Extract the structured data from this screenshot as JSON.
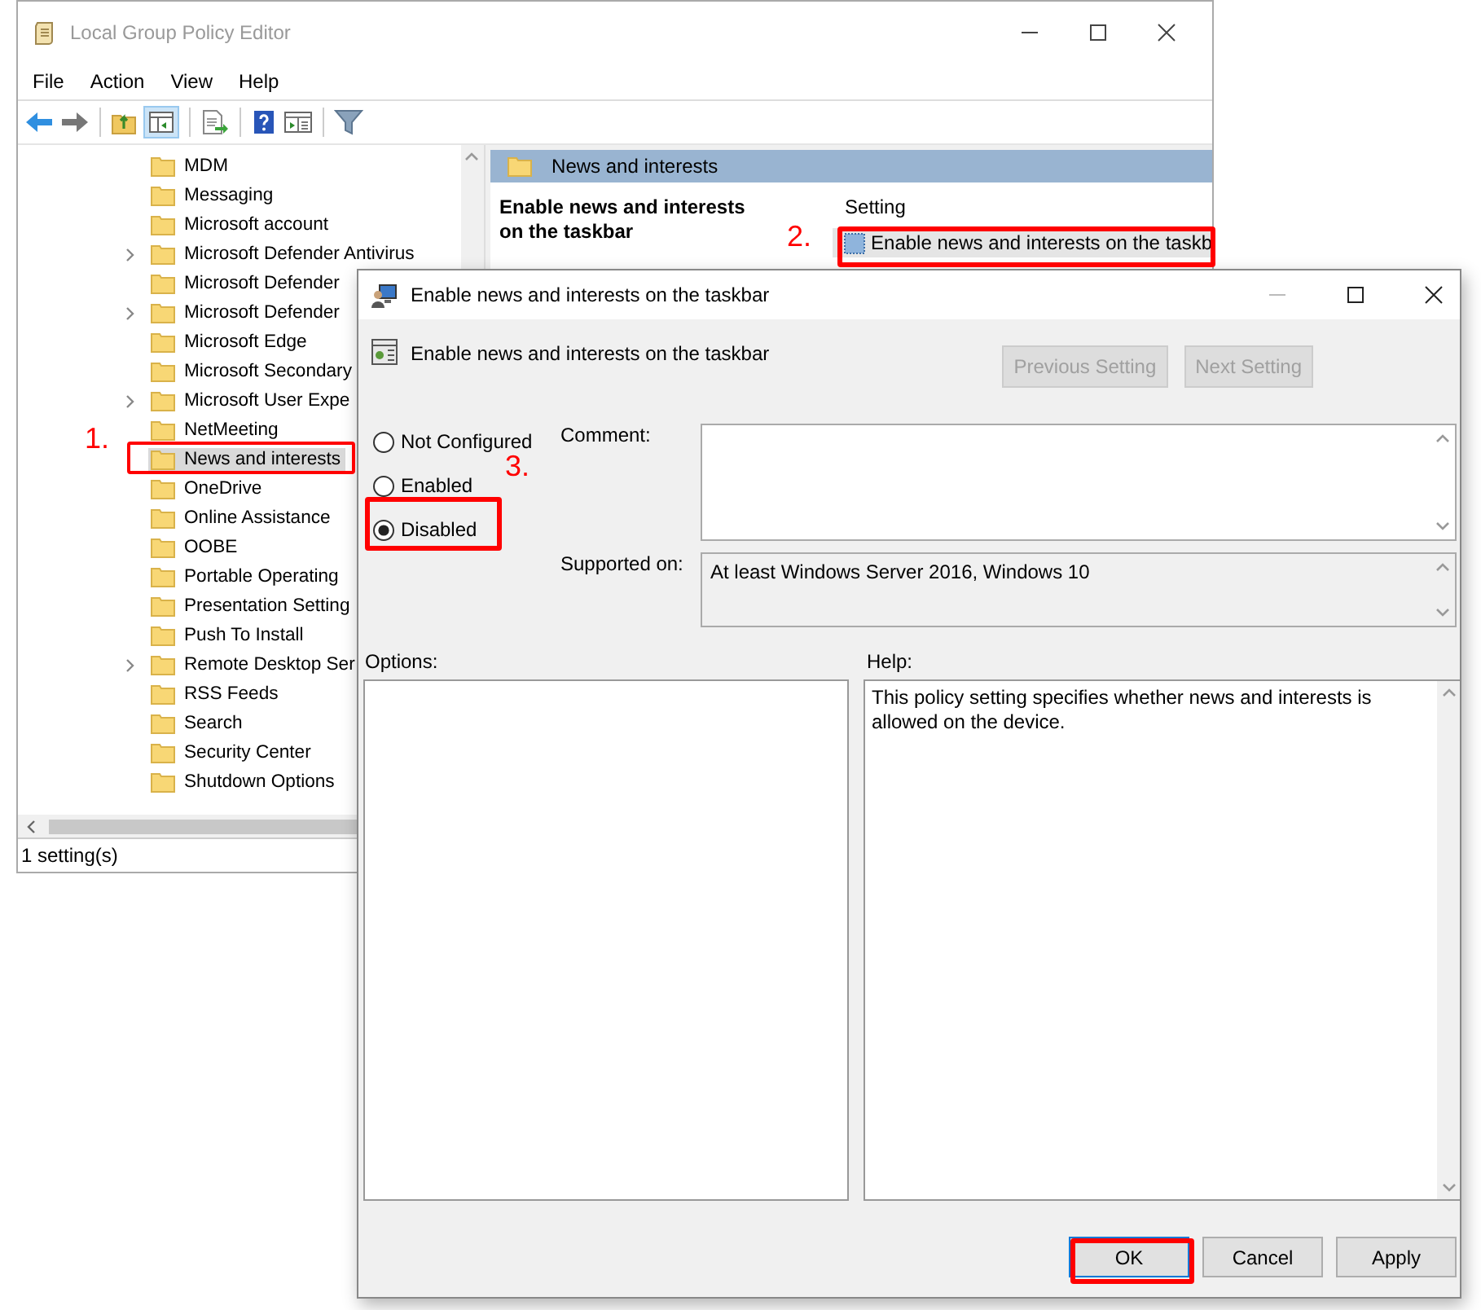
{
  "main_window": {
    "title": "Local Group Policy Editor",
    "menu": [
      "File",
      "Action",
      "View",
      "Help"
    ],
    "tree": [
      {
        "label": "MDM",
        "expandable": false,
        "selected": false
      },
      {
        "label": "Messaging",
        "expandable": false,
        "selected": false
      },
      {
        "label": "Microsoft account",
        "expandable": false,
        "selected": false
      },
      {
        "label": "Microsoft Defender Antivirus",
        "expandable": true,
        "selected": false
      },
      {
        "label": "Microsoft Defender",
        "expandable": false,
        "selected": false
      },
      {
        "label": "Microsoft Defender",
        "expandable": true,
        "selected": false
      },
      {
        "label": "Microsoft Edge",
        "expandable": false,
        "selected": false
      },
      {
        "label": "Microsoft Secondary",
        "expandable": false,
        "selected": false
      },
      {
        "label": "Microsoft User Expe",
        "expandable": true,
        "selected": false
      },
      {
        "label": "NetMeeting",
        "expandable": false,
        "selected": false
      },
      {
        "label": "News and interests",
        "expandable": false,
        "selected": true
      },
      {
        "label": "OneDrive",
        "expandable": false,
        "selected": false
      },
      {
        "label": "Online Assistance",
        "expandable": false,
        "selected": false
      },
      {
        "label": "OOBE",
        "expandable": false,
        "selected": false
      },
      {
        "label": "Portable Operating",
        "expandable": false,
        "selected": false
      },
      {
        "label": "Presentation Setting",
        "expandable": false,
        "selected": false
      },
      {
        "label": "Push To Install",
        "expandable": false,
        "selected": false
      },
      {
        "label": "Remote Desktop Ser",
        "expandable": true,
        "selected": false
      },
      {
        "label": "RSS Feeds",
        "expandable": false,
        "selected": false
      },
      {
        "label": "Search",
        "expandable": false,
        "selected": false
      },
      {
        "label": "Security Center",
        "expandable": false,
        "selected": false
      },
      {
        "label": "Shutdown Options",
        "expandable": false,
        "selected": false
      }
    ],
    "detail": {
      "heading": "News and interests",
      "description": "Enable news and interests on the taskbar",
      "column": "Setting",
      "rows": [
        {
          "label": "Enable news and interests on the taskb"
        }
      ]
    },
    "status_bar": "1 setting(s)"
  },
  "dialog": {
    "title": "Enable news and interests on the taskbar",
    "heading": "Enable news and interests on the taskbar",
    "nav_buttons": [
      {
        "label": "Previous Setting",
        "disabled": true
      },
      {
        "label": "Next Setting",
        "disabled": true
      }
    ],
    "states": [
      {
        "label": "Not Configured",
        "selected": false
      },
      {
        "label": "Enabled",
        "selected": false
      },
      {
        "label": "Disabled",
        "selected": true
      }
    ],
    "comment_label": "Comment:",
    "supported_label": "Supported on:",
    "supported_value": "At least Windows Server 2016, Windows 10",
    "options_label": "Options:",
    "help_label": "Help:",
    "help_text": "This policy setting specifies whether news and interests is allowed on the device.",
    "buttons": [
      "OK",
      "Cancel",
      "Apply"
    ]
  },
  "annotations": [
    {
      "label": "1."
    },
    {
      "label": "2."
    },
    {
      "label": "3."
    }
  ]
}
